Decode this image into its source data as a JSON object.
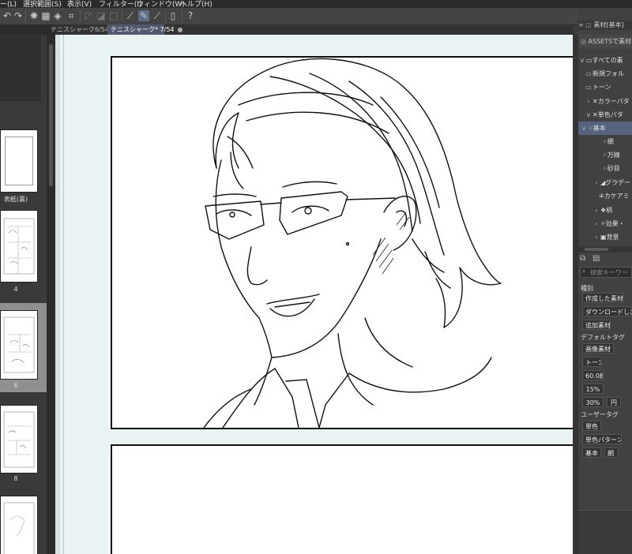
{
  "menu": {
    "items": [
      "ー(L)",
      "選択範囲(S)",
      "表示(V)",
      "フィルター(I)",
      "ウィンドウ(W)",
      "ヘルプ(H)"
    ]
  },
  "toolbar": {
    "icons": [
      "undo-icon",
      "redo-icon",
      "loading-icon",
      "crop-icon",
      "transform-icon",
      "flip-icon",
      "fill-icon",
      "pen-tool-icon",
      "vector-pen-icon",
      "eraser-line-icon",
      "tablet-icon",
      "help-icon"
    ]
  },
  "tabs": [
    {
      "label": "テニスシャーク6/54",
      "close": "×"
    },
    {
      "label": "テニスシャーク* 7/54",
      "close": "●"
    }
  ],
  "pages": [
    {
      "label": "表紙(裏)"
    },
    {
      "label": "4"
    },
    {
      "label": "6"
    },
    {
      "label": "8"
    },
    {
      "label": ""
    }
  ],
  "material_panel": {
    "header_tab": "素材[基本]",
    "assets_label": "ASSETSで素材を",
    "tree": [
      {
        "label": "すべての素",
        "icon": "folder-icon",
        "expand": "v"
      },
      {
        "label": "新規フォル",
        "icon": "folder-icon",
        "expand": ""
      },
      {
        "label": "トーン",
        "icon": "folder-icon",
        "expand": ""
      },
      {
        "label": "カラーパタ",
        "icon": "color-pattern-icon",
        "expand": ">"
      },
      {
        "label": "単色パタ",
        "icon": "mono-pattern-icon",
        "expand": "v"
      },
      {
        "label": "基本",
        "icon": "dots-icon",
        "expand": "v"
      },
      {
        "label": "網",
        "icon": "dots-icon",
        "expand": ""
      },
      {
        "label": "万線",
        "icon": "dots-icon",
        "expand": ""
      },
      {
        "label": "砂目",
        "icon": "dots-icon",
        "expand": ""
      },
      {
        "label": "グラデー",
        "icon": "gradient-icon",
        "expand": ">"
      },
      {
        "label": "カケアミ",
        "icon": "crosshatch-icon",
        "expand": ""
      },
      {
        "label": "柄",
        "icon": "pattern-icon",
        "expand": ">"
      },
      {
        "label": "効果・",
        "icon": "effect-icon",
        "expand": ">"
      },
      {
        "label": "背景",
        "icon": "image-icon",
        "expand": ">"
      }
    ],
    "search_placeholder": "検索キーワー",
    "kind_label": "種別",
    "kind_buttons": [
      "作成した素材",
      "ダウンロードした素",
      "追加素材"
    ],
    "default_tag_label": "デフォルトタグ",
    "default_tags": [
      "画像素材",
      "トーン",
      "60.0線",
      "15%",
      "30%",
      "円"
    ],
    "user_tag_label": "ユーザータグ",
    "user_tags": [
      "単色",
      "単色パターン",
      "基本",
      "網"
    ]
  }
}
